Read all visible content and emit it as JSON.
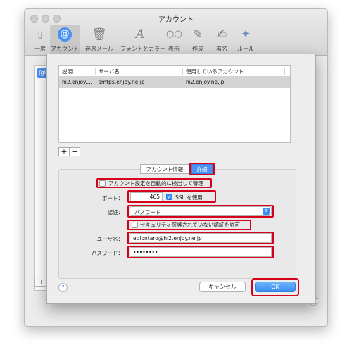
{
  "window": {
    "title": "アカウント"
  },
  "toolbar": {
    "items": [
      {
        "label": "一般",
        "icon": "switch-icon"
      },
      {
        "label": "アカウント",
        "icon": "at-icon",
        "selected": true
      },
      {
        "label": "迷惑メール",
        "icon": "trash-junk-icon"
      },
      {
        "label": "フォントとカラー",
        "icon": "font-icon"
      },
      {
        "label": "表示",
        "icon": "glasses-icon"
      },
      {
        "label": "作成",
        "icon": "pencil-icon"
      },
      {
        "label": "署名",
        "icon": "signature-icon"
      },
      {
        "label": "ルール",
        "icon": "rules-icon"
      }
    ]
  },
  "table": {
    "headers": [
      "説明",
      "サーバ名",
      "使用しているアカウント"
    ],
    "rows": [
      [
        "hi2.enjoy....",
        "smtps.enjoy.ne.jp",
        "hi2.enjoy.ne.jp"
      ]
    ]
  },
  "list_controls": {
    "add": "+",
    "remove": "−"
  },
  "tabs": [
    {
      "label": "アカウント情報",
      "selected": false
    },
    {
      "label": "詳細",
      "selected": true
    }
  ],
  "form": {
    "auto_detect_label": "アカウント設定を自動的に検出して管理",
    "auto_detect_checked": false,
    "port_label": "ポート：",
    "port_value": "465",
    "ssl_label": "SSL を使用",
    "ssl_checked": true,
    "auth_label": "認証：",
    "auth_value": "パスワード",
    "allow_insecure_label": "セキュリティ保護されていない認証を許可",
    "allow_insecure_checked": false,
    "username_label": "ユーザ名：",
    "username_value": "ediontaro@hi2.enjoy.ne.jp",
    "password_label": "パスワード：",
    "password_value": "••••••••"
  },
  "buttons": {
    "help": "?",
    "cancel": "キャンセル",
    "ok": "OK"
  },
  "colors": {
    "accent": "#3b8cf6",
    "highlight_box": "#d4001c"
  }
}
